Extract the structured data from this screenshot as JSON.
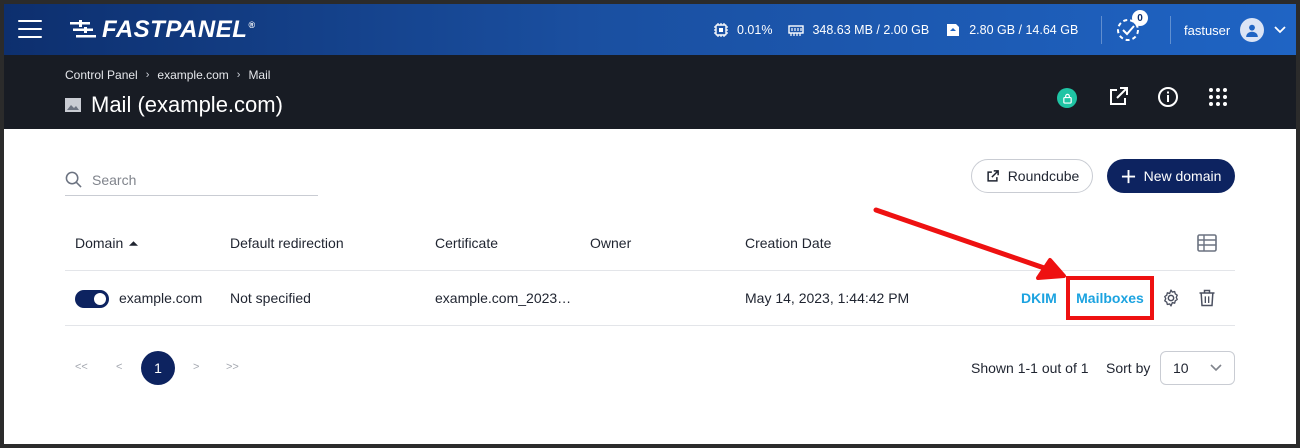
{
  "header": {
    "brand": "FASTPANEL",
    "brand_reg": "®",
    "stats": {
      "cpu": "0.01%",
      "ram": "348.63 MB / 2.00 GB",
      "disk": "2.80 GB / 14.64 GB"
    },
    "tasks_count": "0",
    "username": "fastuser"
  },
  "breadcrumb": {
    "items": [
      "Control Panel",
      "example.com",
      "Mail"
    ],
    "separator": "›"
  },
  "page": {
    "title": "Mail (example.com)"
  },
  "toolbar": {
    "search_placeholder": "Search",
    "roundcube_label": "Roundcube",
    "new_domain_label": "New domain"
  },
  "table": {
    "columns": {
      "domain": "Domain",
      "redirection": "Default redirection",
      "certificate": "Certificate",
      "owner": "Owner",
      "created": "Creation Date"
    },
    "rows": [
      {
        "enabled": true,
        "domain": "example.com",
        "redirection": "Not specified",
        "certificate": "example.com_2023…",
        "owner": "",
        "created": "May 14, 2023, 1:44:42 PM",
        "dkim": "DKIM",
        "mailboxes": "Mailboxes"
      }
    ]
  },
  "pagination": {
    "first": "<<",
    "prev": "<",
    "current": "1",
    "next": ">",
    "last": ">>",
    "shown": "Shown 1-1 out of 1",
    "sort_by": "Sort by",
    "page_size": "10"
  },
  "colors": {
    "primary": "#0d2360",
    "link": "#1ca3e0",
    "highlight": "#ee1111",
    "dark_header": "#181c24"
  }
}
